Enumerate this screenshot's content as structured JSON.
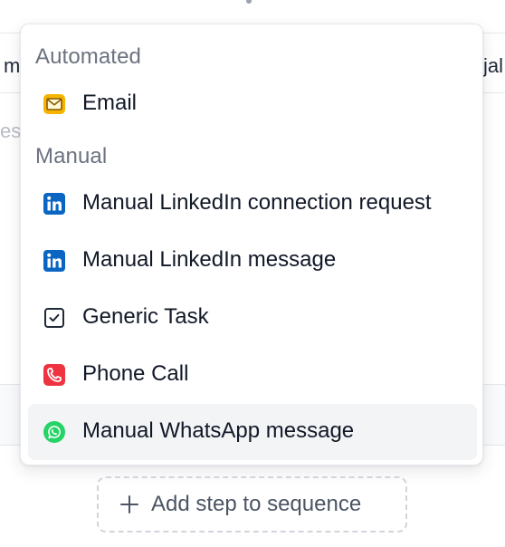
{
  "background": {
    "left_text": "m",
    "right_text": "jal",
    "faded_text": "ess"
  },
  "menu": {
    "sections": [
      {
        "label": "Automated",
        "items": [
          {
            "label": "Email",
            "icon": "email-icon",
            "color": "#f5b400"
          }
        ]
      },
      {
        "label": "Manual",
        "items": [
          {
            "label": "Manual LinkedIn connection request",
            "icon": "linkedin-icon",
            "color": "#0a66c2"
          },
          {
            "label": "Manual LinkedIn message",
            "icon": "linkedin-icon",
            "color": "#0a66c2"
          },
          {
            "label": "Generic Task",
            "icon": "task-checkbox-icon",
            "color": "#1f2937"
          },
          {
            "label": "Phone Call",
            "icon": "phone-icon",
            "color": "#ef3340"
          },
          {
            "label": "Manual WhatsApp message",
            "icon": "whatsapp-icon",
            "color": "#25d366",
            "highlighted": true
          }
        ]
      }
    ]
  },
  "add_step": {
    "label": "Add step to sequence",
    "icon": "plus-icon"
  }
}
